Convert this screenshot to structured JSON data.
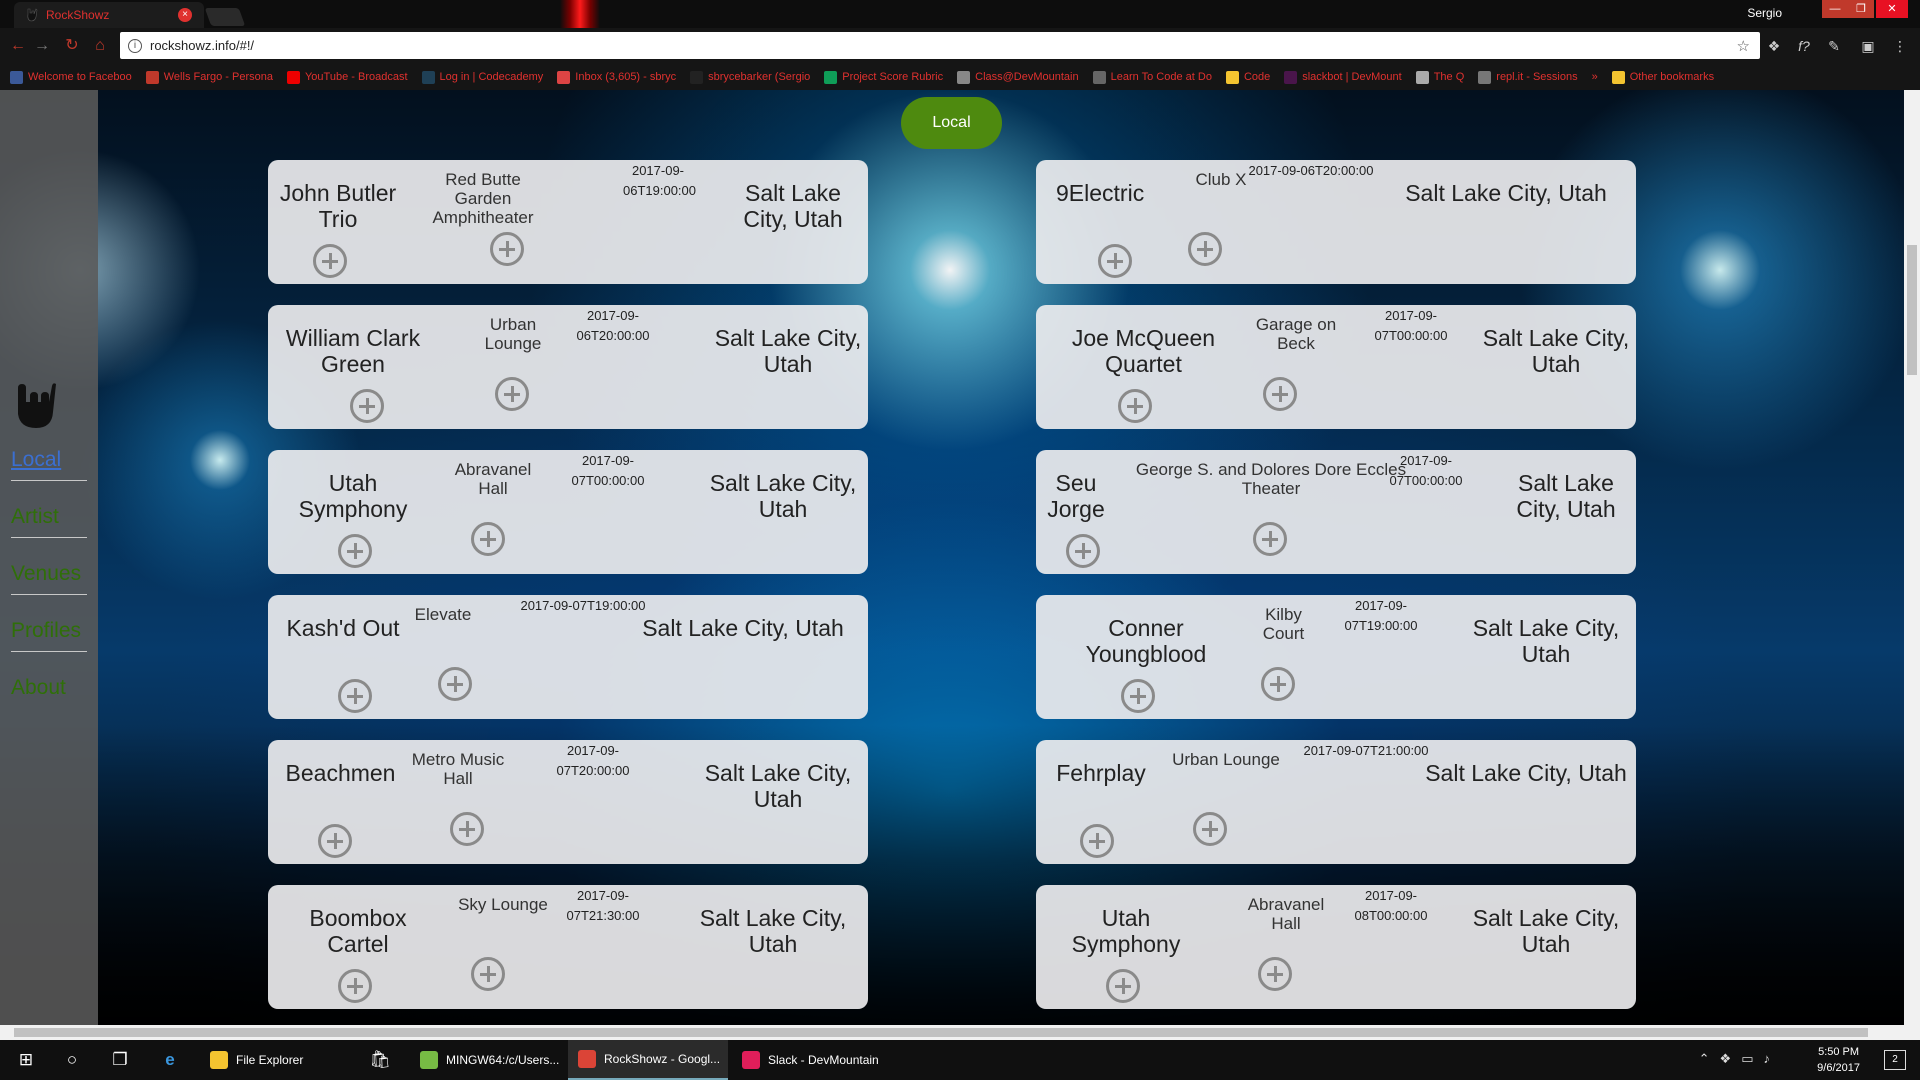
{
  "browser": {
    "tab_title": "RockShowz",
    "tab_close": "×",
    "user": "Sergio",
    "url": "rockshowz.info/#!/",
    "window_min": "—",
    "window_max": "❐",
    "window_close": "✕",
    "bookmarks": [
      {
        "label": "Welcome to Faceboo",
        "icon_color": "#3b5998"
      },
      {
        "label": "Wells Fargo - Persona",
        "icon_color": "#c0392b"
      },
      {
        "label": "YouTube - Broadcast",
        "icon_color": "#e00"
      },
      {
        "label": "Log in | Codecademy",
        "icon_color": "#1f4056"
      },
      {
        "label": "Inbox (3,605) - sbryc",
        "icon_color": "#d44"
      },
      {
        "label": "sbrycebarker (Sergio",
        "icon_color": "#222"
      },
      {
        "label": "Project Score Rubric",
        "icon_color": "#0f9d58"
      },
      {
        "label": "Class@DevMountain",
        "icon_color": "#888"
      },
      {
        "label": "Learn To Code at Do",
        "icon_color": "#666"
      },
      {
        "label": "Code",
        "icon_color": "#f4c430"
      },
      {
        "label": "slackbot | DevMount",
        "icon_color": "#4a154b"
      },
      {
        "label": "The Q",
        "icon_color": "#aaa"
      },
      {
        "label": "repl.it - Sessions",
        "icon_color": "#777"
      },
      {
        "label": "»",
        "icon_color": ""
      },
      {
        "label": "Other bookmarks",
        "icon_color": "#f4c430"
      }
    ]
  },
  "sidebar": {
    "items": [
      {
        "label": "Local"
      },
      {
        "label": "Artist"
      },
      {
        "label": "Venues"
      },
      {
        "label": "Profiles"
      },
      {
        "label": "About"
      }
    ]
  },
  "header": {
    "local_button": "Local"
  },
  "events": [
    {
      "artist": "John Butler Trio",
      "venue": "Red Butte Garden Amphitheater",
      "date": "2017-09-06T19:00:00",
      "city": "Salt Lake City, Utah"
    },
    {
      "artist": "9Electric",
      "venue": "Club X",
      "date": "2017-09-06T20:00:00",
      "city": "Salt Lake City, Utah"
    },
    {
      "artist": "William Clark Green",
      "venue": "Urban Lounge",
      "date": "2017-09-06T20:00:00",
      "city": "Salt Lake City, Utah"
    },
    {
      "artist": "Joe McQueen Quartet",
      "venue": "Garage on Beck",
      "date": "2017-09-07T00:00:00",
      "city": "Salt Lake City, Utah"
    },
    {
      "artist": "Utah Symphony",
      "venue": "Abravanel Hall",
      "date": "2017-09-07T00:00:00",
      "city": "Salt Lake City, Utah"
    },
    {
      "artist": "Seu Jorge",
      "venue": "George S. and Dolores Dore Eccles Theater",
      "date": "2017-09-07T00:00:00",
      "city": "Salt Lake City, Utah"
    },
    {
      "artist": "Kash'd Out",
      "venue": "Elevate",
      "date": "2017-09-07T19:00:00",
      "city": "Salt Lake City, Utah"
    },
    {
      "artist": "Conner Youngblood",
      "venue": "Kilby Court",
      "date": "2017-09-07T19:00:00",
      "city": "Salt Lake City, Utah"
    },
    {
      "artist": "Beachmen",
      "venue": "Metro Music Hall",
      "date": "2017-09-07T20:00:00",
      "city": "Salt Lake City, Utah"
    },
    {
      "artist": "Fehrplay",
      "venue": "Urban Lounge",
      "date": "2017-09-07T21:00:00",
      "city": "Salt Lake City, Utah"
    },
    {
      "artist": "Boombox Cartel",
      "venue": "Sky Lounge",
      "date": "2017-09-07T21:30:00",
      "city": "Salt Lake City, Utah"
    },
    {
      "artist": "Utah Symphony",
      "venue": "Abravanel Hall",
      "date": "2017-09-08T00:00:00",
      "city": "Salt Lake City, Utah"
    }
  ],
  "taskbar": {
    "apps": [
      {
        "label": "File Explorer",
        "icon_color": "#f4c430"
      },
      {
        "label": "MINGW64:/c/Users...",
        "icon_color": "#7b4"
      },
      {
        "label": "RockShowz - Googl...",
        "icon_color": "#db4437"
      },
      {
        "label": "Slack - DevMountain",
        "icon_color": "#e01e5a"
      }
    ],
    "time": "5:50 PM",
    "date": "9/6/2017",
    "notifications": "2"
  }
}
